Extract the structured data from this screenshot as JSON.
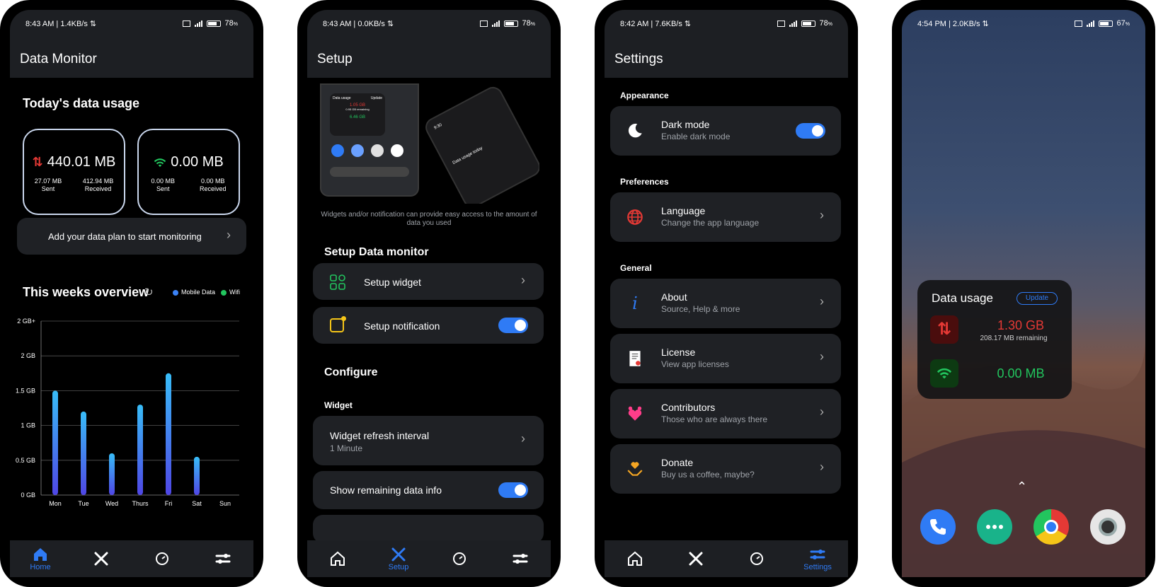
{
  "phone1": {
    "status": {
      "left": "8:43 AM | 1.4KB/s",
      "battery": "78"
    },
    "title": "Data Monitor",
    "today_title": "Today's data usage",
    "mobile": {
      "total": "440.01 MB",
      "sent_value": "27.07 MB",
      "sent_label": "Sent",
      "received_value": "412.94 MB",
      "received_label": "Received"
    },
    "wifi": {
      "total": "0.00 MB",
      "sent_value": "0.00 MB",
      "sent_label": "Sent",
      "received_value": "0.00 MB",
      "received_label": "Received"
    },
    "plan_button": "Add your data plan to start monitoring",
    "week_title": "This weeks overview",
    "legend": [
      "Mobile Data",
      "Wifi"
    ],
    "nav_home": "Home"
  },
  "chart_data": {
    "type": "bar",
    "categories": [
      "Mon",
      "Tue",
      "Wed",
      "Thurs",
      "Fri",
      "Sat",
      "Sun"
    ],
    "series": [
      {
        "name": "Mobile Data",
        "values": [
          1.5,
          1.2,
          0.6,
          1.3,
          1.75,
          0.55,
          0
        ]
      }
    ],
    "y_tick_labels": [
      "0 GB",
      "0.5 GB",
      "1 GB",
      "1.5 GB",
      "2 GB",
      "2 GB+"
    ],
    "ylim": [
      0,
      2.5
    ],
    "grid": true
  },
  "phone2": {
    "status": {
      "left": "8:43 AM | 0.0KB/s",
      "battery": "78"
    },
    "title": "Setup",
    "illustration": {
      "widget_title": "Data usage",
      "widget_update": "Update",
      "widget_mobile": "1.05 GB",
      "widget_remaining": "0.95 GB remaining",
      "widget_wifi": "6.46 GB",
      "notif_time": "9:30",
      "notif_title": "Data usage today"
    },
    "caption": "Widgets and/or notification can provide easy access to the amount of data you used",
    "section_title": "Setup Data monitor",
    "setup_widget": "Setup widget",
    "setup_notification": "Setup notification",
    "configure_title": "Configure",
    "widget_label": "Widget",
    "refresh_title": "Widget refresh interval",
    "refresh_value": "1 Minute",
    "remaining_info": "Show remaining data info",
    "nav_setup": "Setup"
  },
  "phone3": {
    "status": {
      "left": "8:42 AM | 7.6KB/s",
      "battery": "78"
    },
    "title": "Settings",
    "appearance_label": "Appearance",
    "dark_mode": {
      "title": "Dark mode",
      "sub": "Enable dark mode"
    },
    "preferences_label": "Preferences",
    "language": {
      "title": "Language",
      "sub": "Change the app language"
    },
    "general_label": "General",
    "about": {
      "title": "About",
      "sub": "Source, Help & more"
    },
    "license": {
      "title": "License",
      "sub": "View app licenses"
    },
    "contributors": {
      "title": "Contributors",
      "sub": "Those who are always there"
    },
    "donate": {
      "title": "Donate",
      "sub": "Buy us a coffee, maybe?"
    },
    "nav_settings": "Settings"
  },
  "phone4": {
    "status": {
      "left": "4:54 PM | 2.0KB/s",
      "battery": "67"
    },
    "widget_title": "Data usage",
    "update_label": "Update",
    "mobile_value": "1.30 GB",
    "remaining": "208.17 MB remaining",
    "wifi_value": "0.00 MB"
  },
  "colors": {
    "accent": "#2f7bf5",
    "mobile_red": "#e53935",
    "wifi_green": "#22c55e",
    "card": "#1f2125",
    "bar": "#3b82f6"
  }
}
